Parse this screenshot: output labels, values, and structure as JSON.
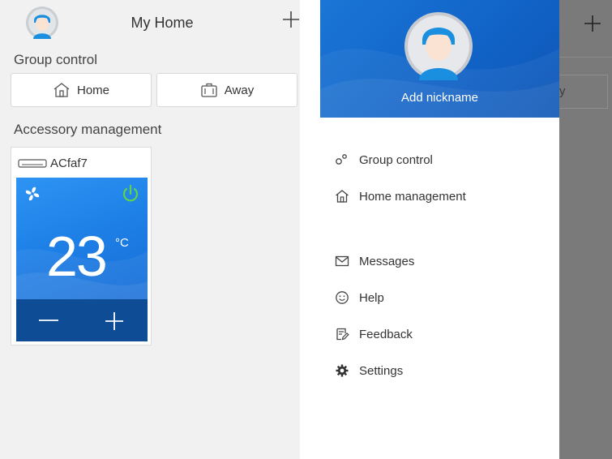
{
  "home": {
    "title": "My Home",
    "group_control_label": "Group control",
    "buttons": {
      "home": "Home",
      "away": "Away"
    },
    "accessory_label": "Accessory management",
    "device": {
      "name": "ACfaf7",
      "temperature": "23",
      "unit": "°C"
    }
  },
  "drawer": {
    "nickname": "Add nickname",
    "menu": [
      {
        "label": "Group control",
        "icon": "group-control-icon"
      },
      {
        "label": "Home management",
        "icon": "home-icon"
      },
      {
        "label": "Messages",
        "icon": "envelope-icon"
      },
      {
        "label": "Help",
        "icon": "smiley-icon"
      },
      {
        "label": "Feedback",
        "icon": "feedback-icon"
      },
      {
        "label": "Settings",
        "icon": "gear-icon"
      }
    ],
    "ghost_text": "y"
  },
  "colors": {
    "accent": "#1a76d6",
    "power": "#5fd34a",
    "overlay": "#7a7a7a"
  }
}
